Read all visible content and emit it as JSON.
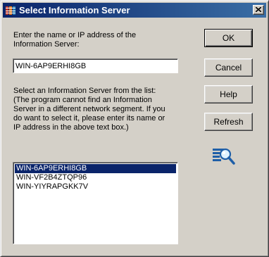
{
  "window": {
    "title": "Select Information Server",
    "title_icon": "network-server-icon",
    "close_glyph": "×"
  },
  "form": {
    "name_label": "Enter the name or IP address of the\nInformation Server:",
    "server_input_value": "WIN-6AP9ERHI8GB",
    "list_label": "Select an Information Server from the list:\n(The program cannot find an Information\nServer in a different network segment. If you\ndo want to select it, please enter its name or\nIP address in the above text box.)"
  },
  "buttons": {
    "ok": "OK",
    "cancel": "Cancel",
    "help": "Help",
    "refresh": "Refresh"
  },
  "servers": [
    {
      "name": "WIN-6AP9ERHI8GB",
      "selected": true
    },
    {
      "name": "WIN-VF2B4ZTQP96",
      "selected": false
    },
    {
      "name": "WIN-YIYRAPGKK7V",
      "selected": false
    }
  ],
  "search_icon": "search-network-icon",
  "colors": {
    "titlebar_start": "#0a246a",
    "titlebar_end": "#3a6ea5",
    "selection": "#0a246a",
    "dialog_bg": "#d4d0c8"
  }
}
